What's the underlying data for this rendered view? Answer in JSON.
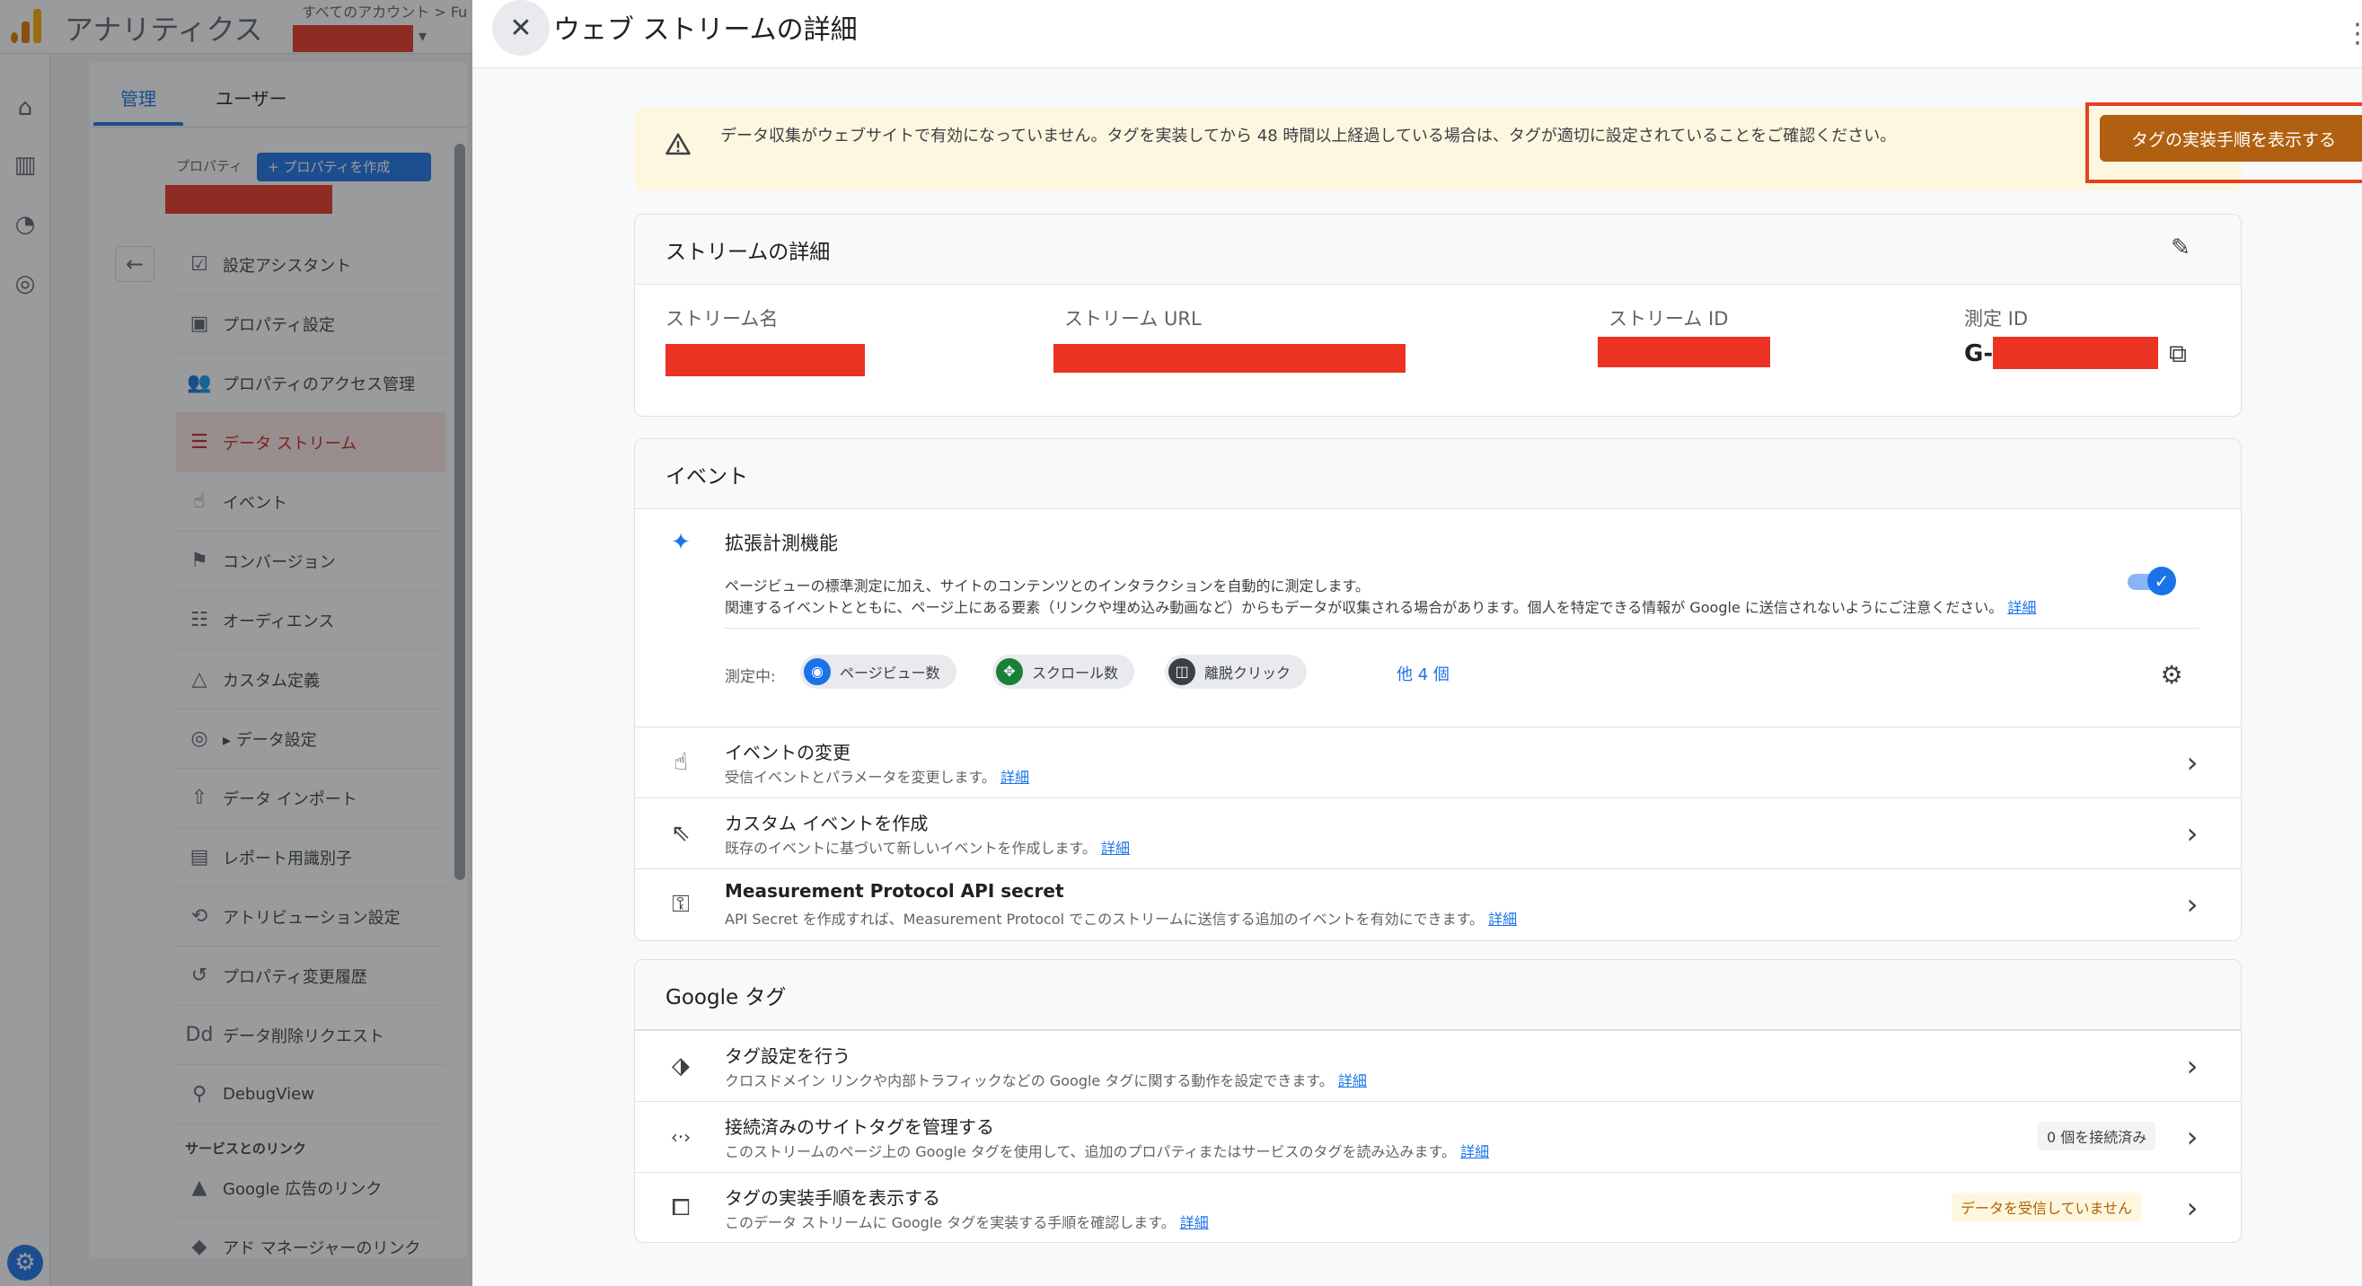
{
  "background": {
    "app_name": "アナリティクス",
    "account_label": "すべてのアカウント > Fu",
    "tabs": [
      {
        "label": "管理"
      },
      {
        "label": "ユーザー"
      }
    ],
    "property_label": "プロパティ",
    "create_property_label": "+ プロパティを作成",
    "menu": [
      {
        "icon": "☑",
        "label": "設定アシスタント"
      },
      {
        "icon": "▣",
        "label": "プロパティ設定"
      },
      {
        "icon": "👥",
        "label": "プロパティのアクセス管理"
      },
      {
        "icon": "☰",
        "label": "データ ストリーム"
      },
      {
        "icon": "☝",
        "label": "イベント"
      },
      {
        "icon": "⚑",
        "label": "コンバージョン"
      },
      {
        "icon": "☷",
        "label": "オーディエンス"
      },
      {
        "icon": "△",
        "label": "カスタム定義"
      },
      {
        "icon": "◎",
        "label": "▸ データ設定"
      },
      {
        "icon": "⇧",
        "label": "データ インポート"
      },
      {
        "icon": "▤",
        "label": "レポート用識別子"
      },
      {
        "icon": "⟲",
        "label": "アトリビューション設定"
      },
      {
        "icon": "↺",
        "label": "プロパティ変更履歴"
      },
      {
        "icon": "Dd",
        "label": "データ削除リクエスト"
      },
      {
        "icon": "⚲",
        "label": "DebugView"
      }
    ],
    "links_section_title": "サービスとのリンク",
    "links": [
      {
        "icon": "▲",
        "label": "Google 広告のリンク"
      },
      {
        "icon": "◆",
        "label": "アド マネージャーのリンク"
      }
    ]
  },
  "drawer": {
    "title": "ウェブ ストリームの詳細",
    "warning": {
      "text": "データ収集がウェブサイトで有効になっていません。タグを実装してから 48 時間以上経過している場合は、タグが適切に設定されていることをご確認ください。",
      "button_label": "タグの実装手順を表示する"
    },
    "stream_details": {
      "title": "ストリームの詳細",
      "fields": {
        "name_label": "ストリーム名",
        "url_label": "ストリーム URL",
        "id_label": "ストリーム ID",
        "measurement_label": "測定 ID",
        "measurement_prefix": "G-"
      }
    },
    "events": {
      "title": "イベント",
      "enhanced": {
        "title": "拡張計測機能",
        "desc_line1": "ページビューの標準測定に加え、サイトのコンテンツとのインタラクションを自動的に測定します。",
        "desc_line2": "関連するイベントとともに、ページ上にある要素（リンクや埋め込み動画など）からもデータが収集される場合があります。個人を特定できる情報が Google に送信されないようにご注意ください。",
        "detail_link": "詳細",
        "measuring_label": "測定中:",
        "chips": [
          {
            "label": "ページビュー数",
            "color": "#1a73e8"
          },
          {
            "label": "スクロール数",
            "color": "#188038"
          },
          {
            "label": "離脱クリック",
            "color": "#3c4043"
          }
        ],
        "more_label": "他 4 個"
      },
      "rows": [
        {
          "title": "イベントの変更",
          "desc": "受信イベントとパラメータを変更します。",
          "link": "詳細"
        },
        {
          "title": "カスタム イベントを作成",
          "desc": "既存のイベントに基づいて新しいイベントを作成します。",
          "link": "詳細"
        },
        {
          "title": "Measurement Protocol API secret",
          "desc": "API Secret を作成すれば、Measurement Protocol でこのストリームに送信する追加のイベントを有効にできます。",
          "link": "詳細"
        }
      ]
    },
    "google_tag": {
      "title": "Google タグ",
      "rows": [
        {
          "title": "タグ設定を行う",
          "desc": "クロスドメイン リンクや内部トラフィックなどの Google タグに関する動作を設定できます。",
          "link": "詳細",
          "badge": ""
        },
        {
          "title": "接続済みのサイトタグを管理する",
          "desc": "このストリームのページ上の Google タグを使用して、追加のプロパティまたはサービスのタグを読み込みます。",
          "link": "詳細",
          "badge": "0 個を接続済み"
        },
        {
          "title": "タグの実装手順を表示する",
          "desc": "このデータ ストリームに Google タグを実装する手順を確認します。",
          "link": "詳細",
          "badge": "データを受信していません"
        }
      ]
    }
  }
}
